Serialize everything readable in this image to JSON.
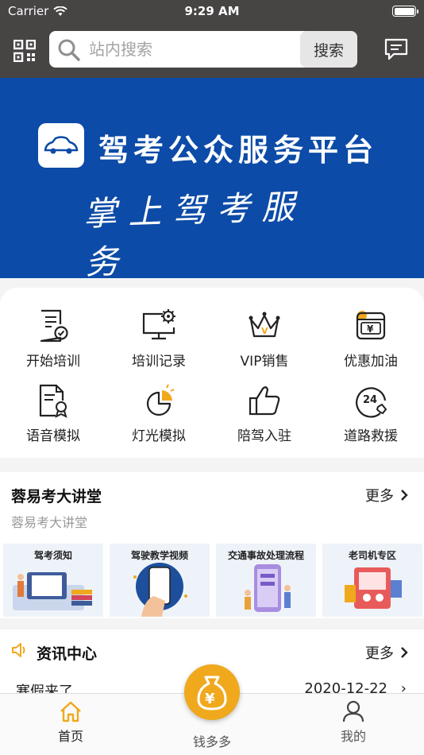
{
  "status_bar": {
    "carrier": "Carrier",
    "time": "9:29 AM"
  },
  "header": {
    "search_placeholder": "站内搜索",
    "search_button": "搜索"
  },
  "banner": {
    "title": "驾考公众服务平台",
    "subtitle": "掌上驾考服务"
  },
  "functions": [
    {
      "label": "开始培训",
      "icon": "training-doc-icon"
    },
    {
      "label": "培训记录",
      "icon": "monitor-gear-icon"
    },
    {
      "label": "VIP销售",
      "icon": "crown-icon"
    },
    {
      "label": "优惠加油",
      "icon": "fuel-coupon-icon"
    },
    {
      "label": "语音模拟",
      "icon": "certificate-doc-icon"
    },
    {
      "label": "灯光模拟",
      "icon": "light-pie-icon"
    },
    {
      "label": "陪驾入驻",
      "icon": "thumbs-up-icon"
    },
    {
      "label": "道路救援",
      "icon": "phone-24-icon"
    }
  ],
  "lecture": {
    "title": "蓉易考大讲堂",
    "more": "更多",
    "subtitle": "蓉易考大讲堂",
    "cards": [
      {
        "label": "驾考须知"
      },
      {
        "label": "驾驶教学视频"
      },
      {
        "label": "交通事故处理流程"
      },
      {
        "label": "老司机专区"
      }
    ]
  },
  "news": {
    "title": "资讯中心",
    "more": "更多",
    "items": [
      {
        "title": "寒假来了",
        "date": "2020-12-22"
      }
    ]
  },
  "tabbar": {
    "home": "首页",
    "money": "钱多多",
    "mine": "我的"
  },
  "colors": {
    "accent": "#f0a81d",
    "banner_blue": "#0c4ba7",
    "header_dark": "#474444"
  }
}
